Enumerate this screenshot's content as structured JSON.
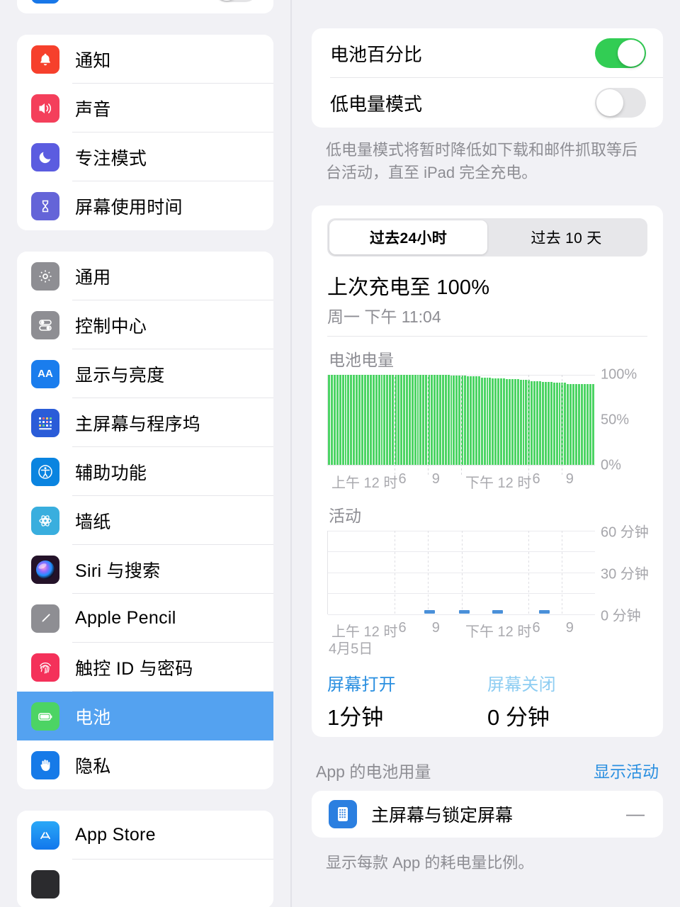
{
  "sidebar": {
    "partial_top_row": {
      "label": "",
      "icon": "blue-app-icon",
      "toggle": "off"
    },
    "groups": [
      {
        "items": [
          {
            "label": "通知",
            "icon": "bell-icon",
            "color": "#f6402c"
          },
          {
            "label": "声音",
            "icon": "speaker-icon",
            "color": "#f43f5b"
          },
          {
            "label": "专注模式",
            "icon": "moon-icon",
            "color": "#5b5ce0"
          },
          {
            "label": "屏幕使用时间",
            "icon": "hourglass-icon",
            "color": "#6464d8"
          }
        ]
      },
      {
        "items": [
          {
            "label": "通用",
            "icon": "gear-icon",
            "color": "#8e8e93"
          },
          {
            "label": "控制中心",
            "icon": "sliders-icon",
            "color": "#8e8e93"
          },
          {
            "label": "显示与亮度",
            "icon": "aa-text-icon",
            "color": "#1a7ded"
          },
          {
            "label": "主屏幕与程序坞",
            "icon": "home-grid-icon",
            "color": "#2a5cd8"
          },
          {
            "label": "辅助功能",
            "icon": "accessibility-icon",
            "color": "#0a84e0"
          },
          {
            "label": "墙纸",
            "icon": "flower-icon",
            "color": "#39aede"
          },
          {
            "label": "Siri 与搜索",
            "icon": "siri-icon",
            "color": "#2b1a33"
          },
          {
            "label": "Apple Pencil",
            "icon": "pencil-icon",
            "color": "#8e8e93"
          },
          {
            "label": "触控 ID 与密码",
            "icon": "fingerprint-icon",
            "color": "#f4315a"
          },
          {
            "label": "电池",
            "icon": "battery-icon",
            "color": "#4cd464",
            "selected": true
          },
          {
            "label": "隐私",
            "icon": "hand-icon",
            "color": "#167ae8"
          }
        ]
      },
      {
        "items": [
          {
            "label": "App Store",
            "icon": "appstore-icon",
            "color": "#1f9ef5"
          }
        ]
      }
    ],
    "selected_color": "#54a2f0"
  },
  "detail": {
    "settings_card": {
      "rows": [
        {
          "label": "电池百分比",
          "toggle": "on"
        },
        {
          "label": "低电量模式",
          "toggle": "off"
        }
      ],
      "footnote": "低电量模式将暂时降低如下载和邮件抓取等后台活动，直至 iPad 完全充电。"
    },
    "battery_card": {
      "segments": [
        {
          "label": "过去24小时",
          "active": true
        },
        {
          "label": "过去 10 天",
          "active": false
        }
      ],
      "last_charge_title": "上次充电至 100%",
      "last_charge_sub": "周一 下午 11:04",
      "stats": [
        {
          "key": "屏幕打开",
          "value": "1分钟",
          "color": "#2a8fe0"
        },
        {
          "key": "屏幕关闭",
          "value": "0 分钟",
          "color": "#8ecdf2"
        }
      ],
      "usage_header": {
        "label": "App 的电池用量",
        "action": "显示活动"
      },
      "apps": [
        {
          "name": "主屏幕与锁定屏幕",
          "value": "—",
          "icon": "home-lock-screen-icon"
        }
      ],
      "apps_note": "显示每款 App 的耗电量比例。"
    }
  },
  "chart_data": [
    {
      "type": "bar",
      "title": "电池电量",
      "xlabel": "",
      "ylabel": "",
      "ylim": [
        0,
        100
      ],
      "yticks": [
        "100%",
        "50%",
        "0%"
      ],
      "ytick_values": [
        100,
        50,
        0
      ],
      "xticks": [
        "上午 12 时",
        "6",
        "9",
        "下午 12 时",
        "6",
        "9"
      ],
      "xtick_positions": [
        0,
        25,
        37.5,
        50,
        75,
        87.5
      ],
      "date_label": "",
      "bar_color": "#4cd464",
      "grid": true,
      "values": [
        100,
        100,
        100,
        100,
        100,
        100,
        100,
        100,
        100,
        100,
        100,
        100,
        100,
        100,
        100,
        100,
        100,
        100,
        100,
        100,
        100,
        100,
        100,
        100,
        100,
        100,
        100,
        100,
        100,
        100,
        100,
        100,
        100,
        100,
        100,
        100,
        100,
        100,
        100,
        100,
        100,
        100,
        100,
        100,
        99,
        99,
        99,
        99,
        99,
        99,
        98,
        98,
        98,
        98,
        98,
        97,
        97,
        97,
        97,
        96,
        96,
        96,
        96,
        96,
        95,
        95,
        95,
        95,
        95,
        94,
        94,
        94,
        94,
        93,
        93,
        93,
        93,
        92,
        92,
        92,
        92,
        91,
        91,
        91,
        91,
        91,
        90,
        90,
        90,
        90,
        90,
        90,
        90,
        90,
        90,
        90
      ]
    },
    {
      "type": "bar",
      "title": "活动",
      "xlabel": "",
      "ylabel": "",
      "ylim": [
        0,
        60
      ],
      "yticks": [
        "60 分钟",
        "30 分钟",
        "0 分钟"
      ],
      "ytick_values": [
        60,
        30,
        0
      ],
      "xticks": [
        "上午 12 时",
        "6",
        "9",
        "下午 12 时",
        "6",
        "9"
      ],
      "xtick_positions": [
        0,
        25,
        37.5,
        50,
        75,
        87.5
      ],
      "date_label": "4月5日",
      "bar_color": "#4a90d9",
      "grid": true,
      "bars": [
        {
          "x_pct": 36.0,
          "width_pct": 4.0,
          "value": 1
        },
        {
          "x_pct": 49.0,
          "width_pct": 4.0,
          "value": 1
        },
        {
          "x_pct": 61.5,
          "width_pct": 4.0,
          "value": 1
        },
        {
          "x_pct": 79.0,
          "width_pct": 4.0,
          "value": 1
        }
      ]
    }
  ]
}
